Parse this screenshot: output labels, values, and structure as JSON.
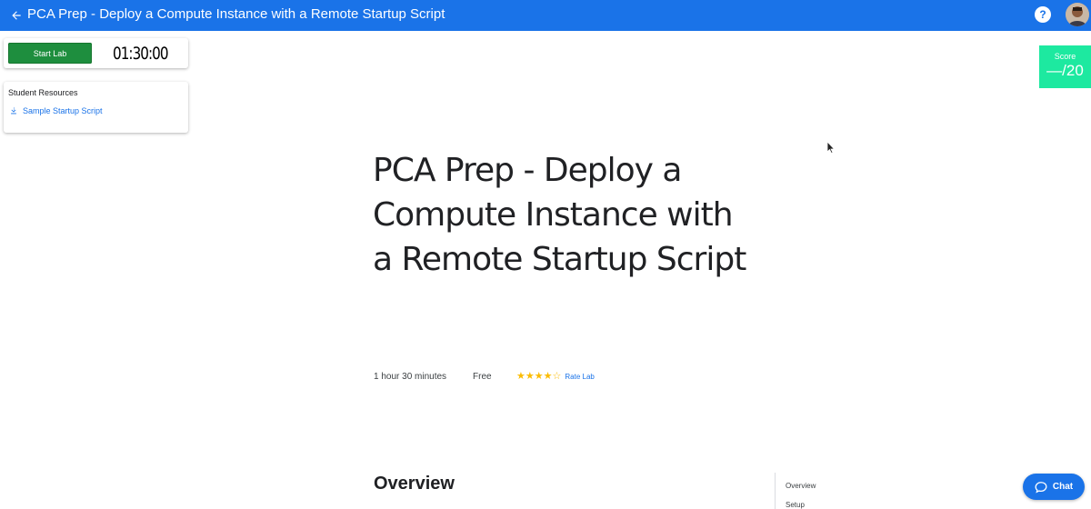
{
  "header": {
    "title": "PCA Prep - Deploy a Compute Instance with a Remote Startup Script",
    "help_label": "?",
    "accent_color": "#1a73e8"
  },
  "lab_controls": {
    "start_label": "Start Lab",
    "timer": "01:30:00"
  },
  "student_resources": {
    "heading": "Student Resources",
    "links": [
      {
        "label": "Sample Startup Script",
        "icon": "download-icon"
      }
    ]
  },
  "score": {
    "label": "Score",
    "value": "—/20",
    "color": "#1de9a0"
  },
  "lab": {
    "title": "PCA Prep - Deploy a Compute Instance with a Remote Startup Script",
    "duration": "1 hour 30 minutes",
    "cost": "Free",
    "rating": 4,
    "rating_max": 5,
    "rate_label": "Rate Lab",
    "star_color": "#fbbc04"
  },
  "content": {
    "overview_heading": "Overview"
  },
  "toc": {
    "items": [
      "Overview",
      "Setup"
    ]
  },
  "chat": {
    "label": "Chat"
  }
}
